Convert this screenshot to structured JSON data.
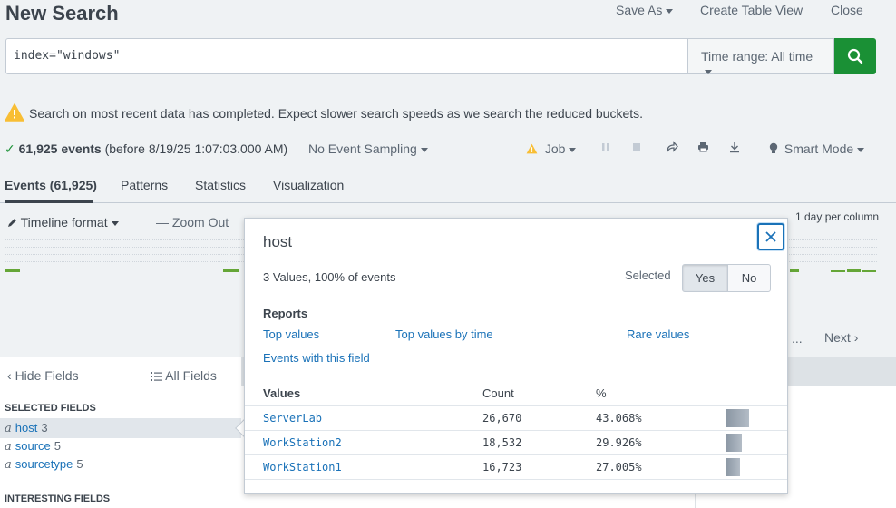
{
  "header": {
    "title": "New Search",
    "save_as": "Save As",
    "create_table_view": "Create Table View",
    "close": "Close"
  },
  "search": {
    "query": "index=\"windows\"",
    "time_range": "Time range: All time"
  },
  "warning": {
    "text": "Search on most recent data has completed. Expect slower search speeds as we search the reduced buckets."
  },
  "status": {
    "events_count": "61,925 events",
    "events_detail": "(before 8/19/25 1:07:03.000 AM)",
    "sampling": "No Event Sampling",
    "job": "Job",
    "smart_mode": "Smart Mode"
  },
  "tabs": [
    {
      "label": "Events (61,925)",
      "active": true
    },
    {
      "label": "Patterns"
    },
    {
      "label": "Statistics"
    },
    {
      "label": "Visualization"
    }
  ],
  "timeline": {
    "format_label": "Timeline format",
    "zoom_out": "Zoom Out",
    "per_column": "1 day per column"
  },
  "pagination": {
    "ellipsis": "...",
    "next": "Next"
  },
  "fields_panel": {
    "hide_fields": "Hide Fields",
    "all_fields": "All Fields",
    "selected_header": "SELECTED FIELDS",
    "selected": [
      {
        "type": "a",
        "name": "host",
        "count": "3"
      },
      {
        "type": "a",
        "name": "source",
        "count": "5"
      },
      {
        "type": "a",
        "name": "sourcetype",
        "count": "5"
      }
    ],
    "interesting_header": "INTERESTING FIELDS"
  },
  "popup": {
    "title": "host",
    "summary": "3 Values, 100% of events",
    "selected_label": "Selected",
    "yes": "Yes",
    "no": "No",
    "reports_label": "Reports",
    "reports": {
      "top_values": "Top values",
      "top_values_by_time": "Top values by time",
      "rare_values": "Rare values",
      "events_with_field": "Events with this field"
    },
    "columns": {
      "values": "Values",
      "count": "Count",
      "percent": "%"
    },
    "values": [
      {
        "name": "ServerLab",
        "count": "26,670",
        "percent": "43.068%",
        "fraction": 0.43068
      },
      {
        "name": "WorkStation2",
        "count": "18,532",
        "percent": "29.926%",
        "fraction": 0.29926
      },
      {
        "name": "WorkStation1",
        "count": "16,723",
        "percent": "27.005%",
        "fraction": 0.27005
      }
    ]
  },
  "colors": {
    "accent_green": "#1a9035",
    "link_blue": "#1a72b8",
    "warning_yellow": "#f8be34"
  }
}
